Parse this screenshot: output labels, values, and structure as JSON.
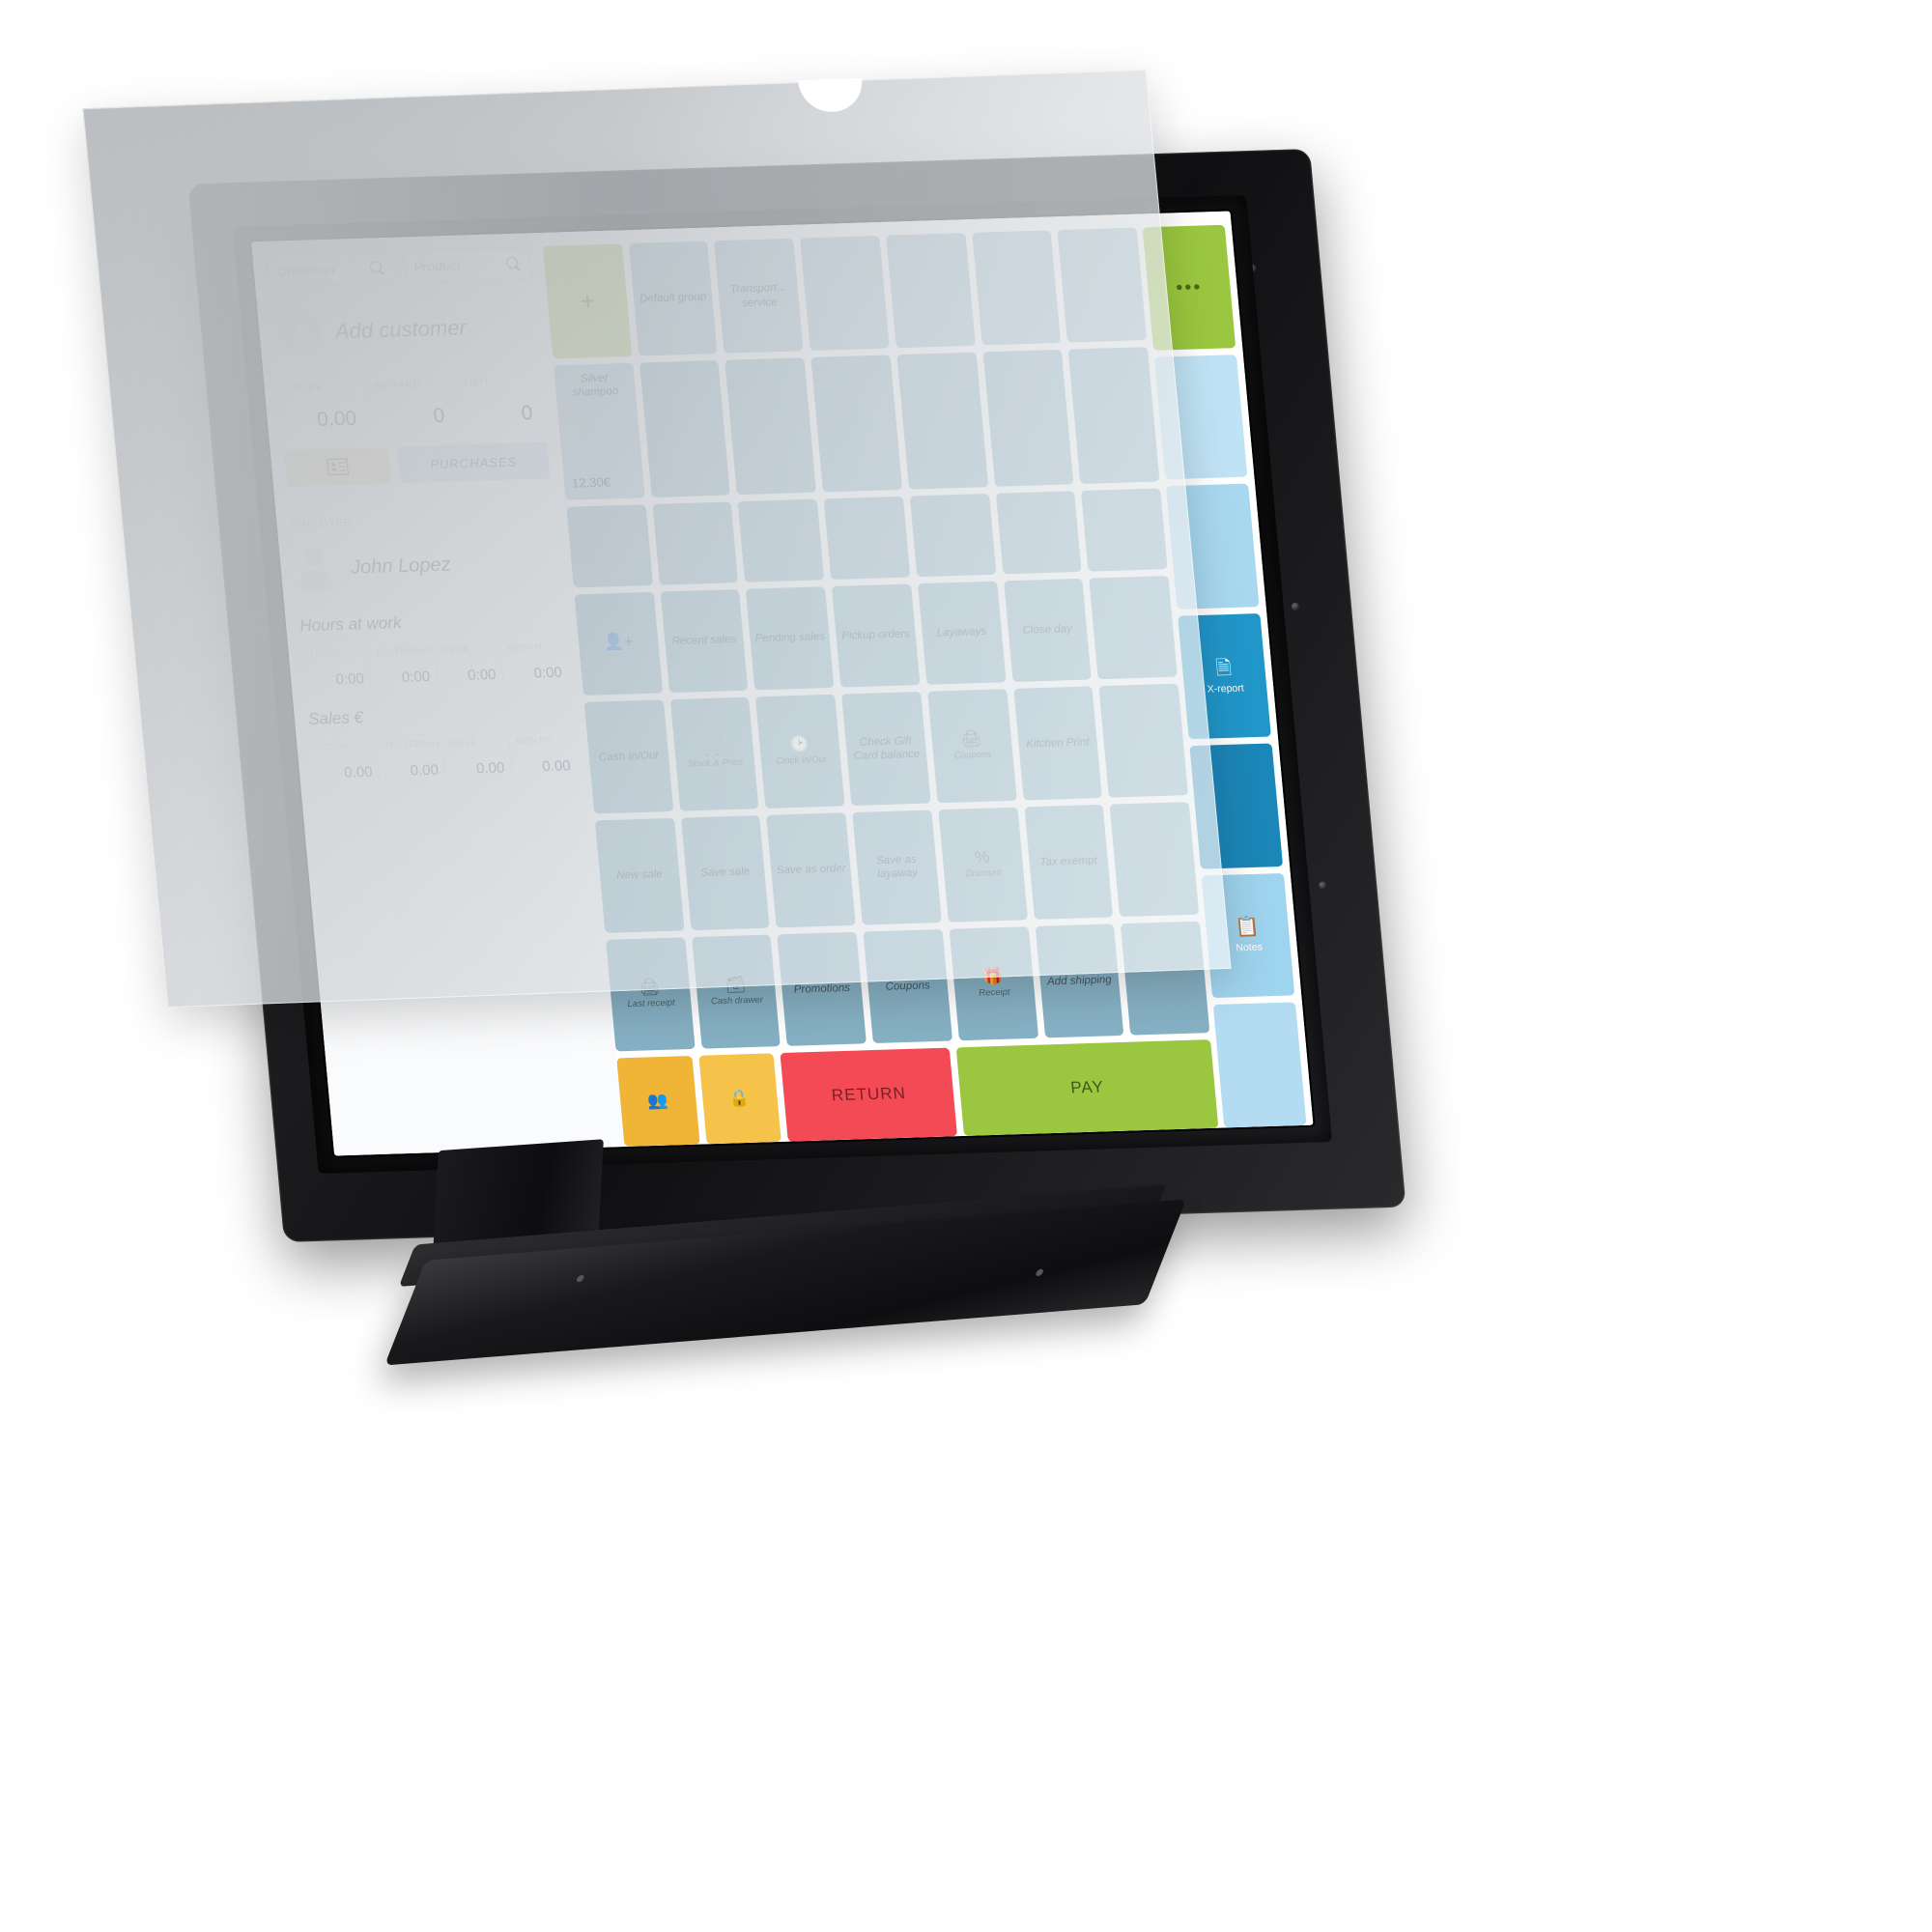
{
  "app": {
    "screen_name": "Point of Sale Register"
  },
  "search": {
    "customer_placeholder": "Customer",
    "product_placeholder": "Product",
    "icon": "search-icon"
  },
  "customer": {
    "add_label": "Add customer",
    "stats": [
      {
        "key": "STORE",
        "value": "0.00"
      },
      {
        "key": "REWARD",
        "value": "0"
      },
      {
        "key": "VISIT",
        "value": "0"
      }
    ],
    "card_button_icon": "contact-card-icon",
    "purchases_label": "PURCHASES"
  },
  "employee": {
    "section_label": "EMPLOYEE",
    "name": "John Lopez",
    "avatar_icon": "person-icon"
  },
  "hours": {
    "title": "Hours at work",
    "columns": [
      "TODAY",
      "YESTERDAY",
      "WEEK",
      "MONTH"
    ],
    "values": [
      "0:00",
      "0:00",
      "0:00",
      "0:00"
    ]
  },
  "sales": {
    "title": "Sales €",
    "columns": [
      "TODAY",
      "YESTERDAY",
      "WEEK",
      "MONTH"
    ],
    "values": [
      "0.00",
      "0.00",
      "0.00",
      "0.00"
    ]
  },
  "product_grid": {
    "add_tile": {
      "label": "+",
      "icon": "plus-icon"
    },
    "groups": [
      "Default group",
      "Transport... service"
    ],
    "product": {
      "name": "Silver shampoo",
      "price": "12.30€"
    }
  },
  "functions": {
    "row1": [
      {
        "label": "",
        "icon": "add-customer-icon"
      },
      {
        "label": "Recent sales",
        "icon": ""
      },
      {
        "label": "Pending sales",
        "icon": ""
      },
      {
        "label": "Pickup orders",
        "icon": ""
      },
      {
        "label": "Layaways",
        "icon": ""
      },
      {
        "label": "Close day",
        "icon": ""
      }
    ],
    "row2": [
      {
        "label": "Cash In/Out",
        "icon": ""
      },
      {
        "label": "Stock & Price",
        "icon": "cart-search-icon"
      },
      {
        "label": "Clock In/Out",
        "icon": "clock-icon"
      },
      {
        "label": "Check Gift Card balance",
        "icon": ""
      },
      {
        "label": "Coupons",
        "icon": "printer-icon"
      },
      {
        "label": "Kitchen Print",
        "icon": ""
      }
    ],
    "row3": [
      {
        "label": "New sale",
        "icon": ""
      },
      {
        "label": "Save sale",
        "icon": ""
      },
      {
        "label": "Save as order",
        "icon": ""
      },
      {
        "label": "Save as layaway",
        "icon": ""
      },
      {
        "label": "Discount",
        "icon": "percent-icon"
      },
      {
        "label": "Tax exempt",
        "icon": ""
      }
    ],
    "row4": [
      {
        "label": "Last receipt",
        "icon": "printer-icon"
      },
      {
        "label": "Cash drawer",
        "icon": "drawer-icon"
      },
      {
        "label": "Promotions",
        "icon": ""
      },
      {
        "label": "Coupons",
        "icon": ""
      },
      {
        "label": "Receipt",
        "icon": "gift-icon"
      },
      {
        "label": "Add shipping",
        "icon": ""
      }
    ]
  },
  "bottom_bar": {
    "customers_icon": "customers-icon",
    "lock_icon": "lock-icon",
    "return_label": "RETURN",
    "pay_label": "PAY"
  },
  "right_rail": [
    {
      "label": "",
      "icon": "more-ellipsis-icon",
      "glyph": "•••",
      "color": "#9ac73f"
    },
    {
      "label": "",
      "icon": "blank-tile",
      "glyph": "",
      "color": "#bfe3f5"
    },
    {
      "label": "",
      "icon": "blank-tile",
      "glyph": "",
      "color": "#a8d8f0"
    },
    {
      "label": "X-report",
      "icon": "report-icon",
      "glyph": "▤",
      "color": "#2196c9"
    },
    {
      "label": "",
      "icon": "blank-tile",
      "glyph": "",
      "color": "#1b86b8"
    },
    {
      "label": "Notes",
      "icon": "notes-icon",
      "glyph": "Ὕ2",
      "color": "#9fd4ee"
    },
    {
      "label": "",
      "icon": "blank-tile",
      "glyph": "",
      "color": "#b3dcf2"
    }
  ],
  "colors": {
    "accent_green": "#9ac73f",
    "accent_blue": "#2196c9",
    "tile_blue": "#86b0c3",
    "return_red": "#f44a55",
    "orange": "#f0b537"
  }
}
